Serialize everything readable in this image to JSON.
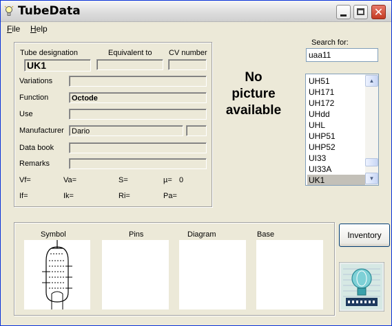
{
  "window": {
    "title": "TubeData"
  },
  "menu": {
    "file": "File",
    "file_rest": "ile",
    "file_key": "F",
    "help_key": "H",
    "help_rest": "elp"
  },
  "labels": {
    "tube_designation": "Tube designation",
    "equivalent_to": "Equivalent to",
    "cv_number": "CV number",
    "variations": "Variations",
    "function": "Function",
    "use": "Use",
    "manufacturer": "Manufacturer",
    "data_book": "Data book",
    "remarks": "Remarks"
  },
  "values": {
    "tube_designation": "UK1",
    "equivalent_to": "",
    "cv_number": "",
    "variations": "",
    "function": "Octode",
    "use": "",
    "manufacturer": "Dario",
    "manufacturer_code": "",
    "data_book": "",
    "remarks": ""
  },
  "params": {
    "vf": "Vf=",
    "va": "Va=",
    "s": "S=",
    "mu": "µ=",
    "mu_value": "0",
    "if": "If=",
    "ik": "Ik=",
    "ri": "Ri=",
    "pa": "Pa="
  },
  "no_picture": [
    "No",
    "picture",
    "available"
  ],
  "search": {
    "label": "Search for:",
    "value": "uaa11"
  },
  "tube_list": [
    "UH51",
    "UH171",
    "UH172",
    "UHdd",
    "UHL",
    "UHP51",
    "UHP52",
    "UI33",
    "UI33A",
    "UK1"
  ],
  "selected_tube": "UK1",
  "bottom_panels": {
    "symbol": "Symbol",
    "pins": "Pins",
    "diagram": "Diagram",
    "base": "Base"
  },
  "buttons": {
    "inventory": "Inventory"
  },
  "icons": {
    "app": "lightbulb-icon",
    "minimize": "minimize-icon",
    "maximize": "maximize-icon",
    "close": "close-icon",
    "scroll_up": "scroll-up-icon",
    "scroll_down": "scroll-down-icon",
    "logo": "tube-logo-icon"
  },
  "colors": {
    "close_button": "#c33a22",
    "list_selection": "#c3c0b8",
    "logo_bg": "#d6e8e4"
  }
}
